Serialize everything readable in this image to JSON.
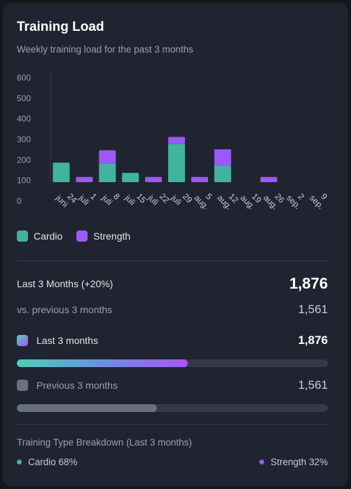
{
  "header": {
    "title": "Training Load",
    "subtitle": "Weekly training load for the past 3 months"
  },
  "colors": {
    "cardio": "#41b39f",
    "strength": "#9b59f5"
  },
  "chart_data": {
    "type": "bar",
    "stacked": true,
    "categories": [
      [
        "24",
        "juni"
      ],
      [
        "1",
        "juli"
      ],
      [
        "8",
        "juli"
      ],
      [
        "15",
        "juli"
      ],
      [
        "22",
        "juli"
      ],
      [
        "29",
        "juli"
      ],
      [
        "5",
        "aug."
      ],
      [
        "12",
        "aug."
      ],
      [
        "19",
        "aug."
      ],
      [
        "26",
        "aug."
      ],
      [
        "2",
        "sep."
      ],
      [
        "9",
        "sep."
      ]
    ],
    "series": [
      {
        "name": "Cardio",
        "values": [
          95,
          0,
          90,
          45,
          0,
          185,
          0,
          80,
          0,
          0,
          0,
          0
        ]
      },
      {
        "name": "Strength",
        "values": [
          0,
          25,
          65,
          0,
          25,
          35,
          25,
          80,
          0,
          25,
          0,
          0
        ]
      }
    ],
    "yticks": [
      "0",
      "100",
      "200",
      "300",
      "400",
      "500",
      "600"
    ],
    "ylim": [
      0,
      600
    ],
    "grid": false,
    "legend": "bottom-left"
  },
  "legend": {
    "cardio": "Cardio",
    "strength": "Strength"
  },
  "summary": {
    "period_label": "Last 3 Months (+20%)",
    "period_value": "1,876",
    "compare_label": "vs. previous 3 months",
    "compare_value": "1,561"
  },
  "comparison": {
    "current_label": "Last 3 months",
    "current_value": "1,876",
    "current_fraction": 0.55,
    "previous_label": "Previous 3 months",
    "previous_value": "1,561",
    "previous_fraction": 0.45
  },
  "breakdown": {
    "title": "Training Type Breakdown (Last 3 months)",
    "cardio": "Cardio 68%",
    "strength": "Strength 32%"
  }
}
